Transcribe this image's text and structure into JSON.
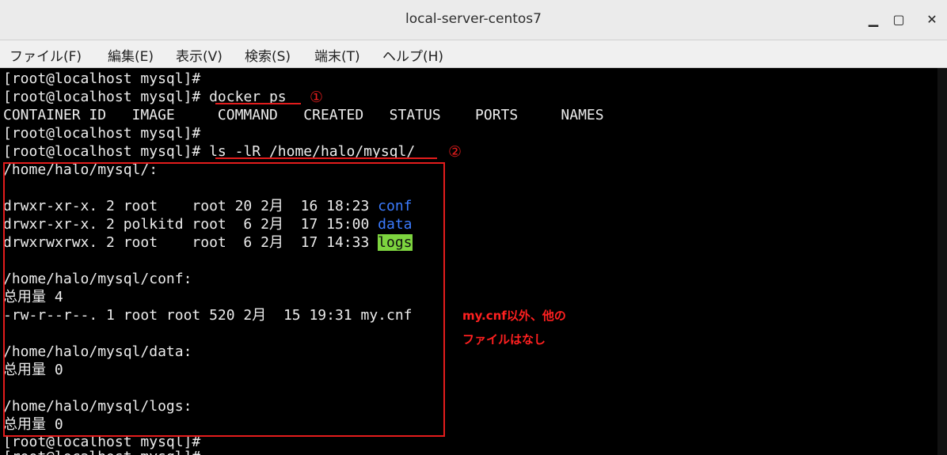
{
  "window": {
    "title": "local-server-centos7",
    "buttons": {
      "minimize": "▁",
      "maximize": "▢",
      "close": "✕"
    }
  },
  "menu": {
    "file": "ファイル(F)",
    "edit": "編集(E)",
    "view": "表示(V)",
    "search": "検索(S)",
    "terminal": "端末(T)",
    "help": "ヘルプ(H)"
  },
  "terminal": {
    "prompt": "[root@localhost mysql]# ",
    "cmd_docker": "docker ps",
    "docker_header": "CONTAINER ID   IMAGE     COMMAND   CREATED   STATUS    PORTS     NAMES",
    "cmd_ls": "ls -lR /home/halo/mysql/",
    "dir_root": "/home/halo/mysql/:",
    "row_conf_meta": "drwxr-xr-x. 2 root    root 20 2月  16 18:23 ",
    "row_conf_name": "conf",
    "row_data_meta": "drwxr-xr-x. 2 polkitd root  6 2月  17 15:00 ",
    "row_data_name": "data",
    "row_logs_meta": "drwxrwxrwx. 2 root    root  6 2月  17 14:33 ",
    "row_logs_name": "logs",
    "dir_conf": "/home/halo/mysql/conf:",
    "total_4": "总用量 4",
    "mycnf_row": "-rw-r--r--. 1 root root 520 2月  15 19:31 my.cnf",
    "dir_data": "/home/halo/mysql/data:",
    "total_0a": "总用量 0",
    "dir_logs": "/home/halo/mysql/logs:",
    "total_0b": "总用量 0",
    "prompt_bottom": "[root@localhost mysql]#",
    "prompt_partial": "[root@localhost mysql]#"
  },
  "annotations": {
    "circle_1": "①",
    "circle_2": "②",
    "note_line1": "my.cnf以外、他の",
    "note_line2": "ファイルはなし",
    "color": "#e31c1c"
  }
}
